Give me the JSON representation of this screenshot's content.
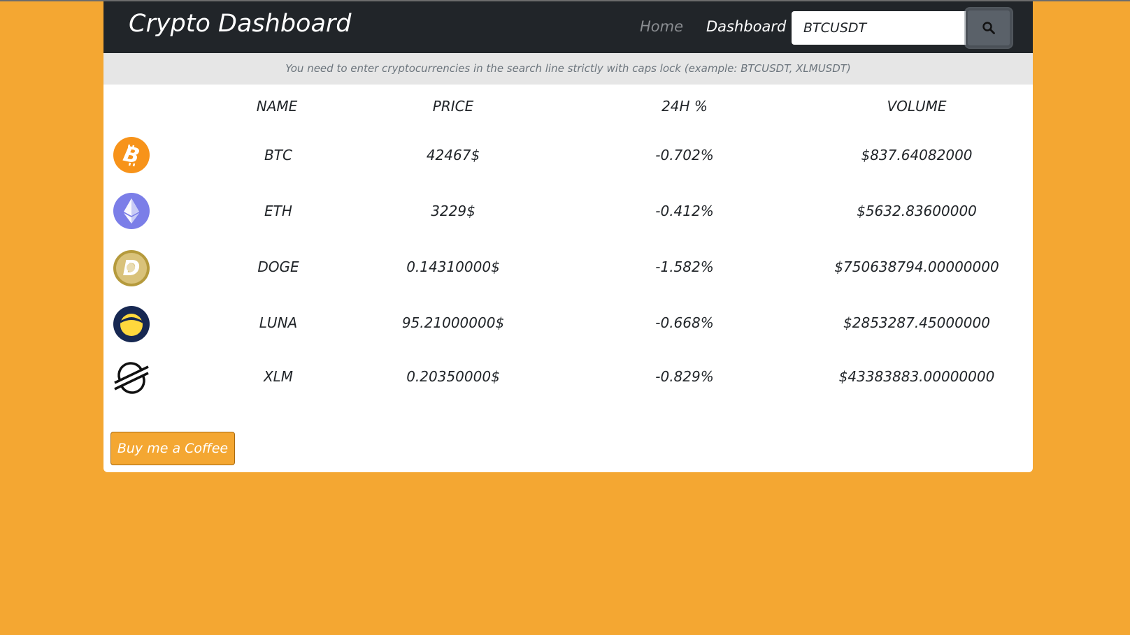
{
  "navbar": {
    "brand": "Crypto Dashboard",
    "links": [
      "Home",
      "Dashboard"
    ],
    "search_value": "BTCUSDT",
    "search_icon": "search-icon"
  },
  "notice": "You need to enter cryptocurrencies in the search line strictly with caps lock (example: BTCUSDT, XLMUSDT)",
  "table": {
    "headers": [
      "NAME",
      "PRICE",
      "24H %",
      "VOLUME"
    ],
    "rows": [
      {
        "icon": "bitcoin-icon",
        "name": "BTC",
        "price": "42467$",
        "change": "-0.702%",
        "volume": "$837.64082000"
      },
      {
        "icon": "ethereum-icon",
        "name": "ETH",
        "price": "3229$",
        "change": "-0.412%",
        "volume": "$5632.83600000"
      },
      {
        "icon": "dogecoin-icon",
        "name": "DOGE",
        "price": "0.14310000$",
        "change": "-1.582%",
        "volume": "$750638794.00000000"
      },
      {
        "icon": "luna-icon",
        "name": "LUNA",
        "price": "95.21000000$",
        "change": "-0.668%",
        "volume": "$2853287.45000000"
      },
      {
        "icon": "stellar-icon",
        "name": "XLM",
        "price": "0.20350000$",
        "change": "-0.829%",
        "volume": "$43383883.00000000"
      }
    ]
  },
  "coffee_button": "Buy me a Coffee",
  "colors": {
    "background": "#f4a732",
    "navbar": "#212529",
    "notice_bar": "#e6e6e6"
  }
}
